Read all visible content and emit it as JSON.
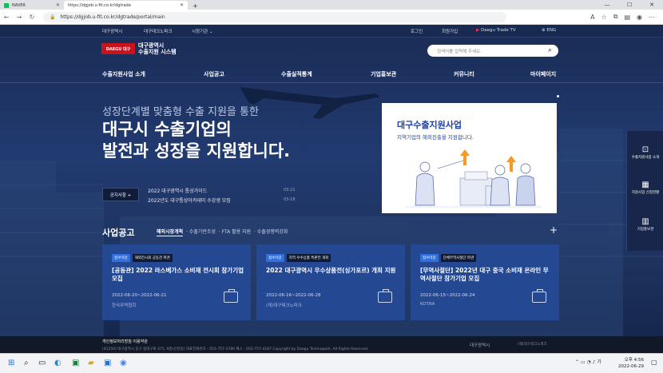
{
  "browser": {
    "tabs": [
      {
        "label": "NAVER",
        "active": false
      },
      {
        "label": "https://dgjob.u-fit.co.kr/dgtrade",
        "active": true
      }
    ],
    "url": "https://dgjob.u-fit.co.kr/dgtrade/portal/main"
  },
  "top_links": {
    "left": [
      "대구광역시",
      "대구테크노파크",
      "시청기관"
    ],
    "right": [
      "로그인",
      "회원가입",
      "Daegu Trade TV",
      "ENG"
    ]
  },
  "logo": {
    "mark": "DAEGU 대구",
    "line1": "대구광역시",
    "line2": "수출지원 시스템"
  },
  "search": {
    "placeholder": "검색어를 입력해 주세요."
  },
  "gnb": [
    "수출지원사업 소개",
    "사업공고",
    "수출실적통계",
    "기업홍보관",
    "커뮤니티",
    "마이페이지"
  ],
  "hero": {
    "subcopy": "성장단계별 맞춤형 수출 지원을 통한",
    "headline1": "대구시 수출기업의",
    "headline2": "발전과 성장을 지원합니다."
  },
  "notice": {
    "button": "공지사항 +",
    "items": [
      {
        "title": "2022 대구광역시 통상가이드",
        "date": "03-21"
      },
      {
        "title": "2022년도 대구통상아카데미 수강생 모집",
        "date": "03-18"
      }
    ]
  },
  "banner": {
    "title": "대구수출지원사업",
    "subtitle": "지역기업의 해외진출을 지원합니다."
  },
  "announce": {
    "title": "사업공고",
    "tabs": [
      "해외시장개척",
      "수출기반조성",
      "FTA 활용 지원",
      "수출경쟁력강화"
    ],
    "plus": "+"
  },
  "cards": [
    {
      "badge1": "접수마감",
      "badge2": "해외전시회 공동관 파견",
      "title": "[공동관] 2022 라스베가스 소비재 전시회 참가기업 모집",
      "date": "2022-06-20~2022-06-21",
      "org": "한국무역협회"
    },
    {
      "badge1": "접수마감",
      "badge2": "지역 우수상품 특판전 개최",
      "title": "2022 대구광역시 우수상품전(싱가포르) 개최 지원",
      "date": "2022-06-16~2022-06-28",
      "org": "(재)대구테크노파크"
    },
    {
      "badge1": "접수마감",
      "badge2": "단체무역사절단 파견",
      "title": "[무역사절단] 2022년 대구 중국 소비재 온라인 무역사절단 참가기업 모집",
      "date": "2022-06-15~2022-06-24",
      "org": "KOTRA"
    }
  ],
  "quick_menu": [
    "수출지원사업 소개",
    "지원사업 신청현황",
    "기업홍보관"
  ],
  "footer": {
    "links": "개인정보처리방침     이용약관",
    "address": "(41250) 대구광역시 동구 동대구로 475, 9층(신천동)  대표전화번호 : 053-757-3780  팩스 : 053-757-4187     Copyright by Daegu Technopark. All Rights Reserved.",
    "org1": "대구광역시",
    "org2": "(재)대구테크노파크"
  },
  "taskbar": {
    "time": "오후 4:56",
    "date": "2022-06-29"
  }
}
